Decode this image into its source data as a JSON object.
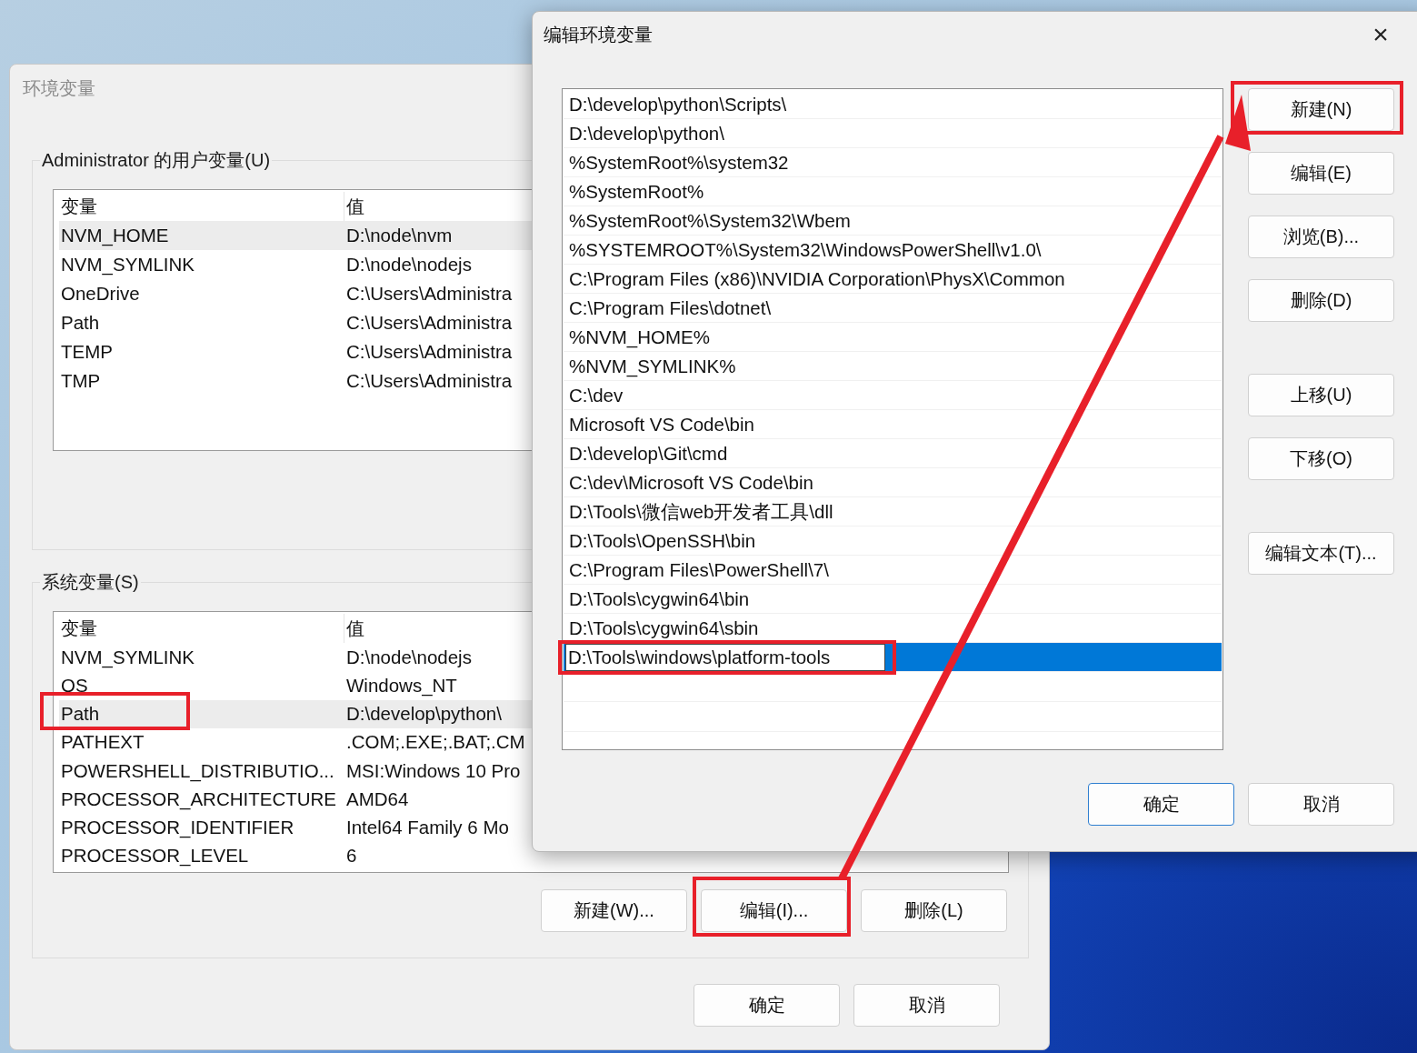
{
  "env_window": {
    "title": "环境变量",
    "user_variables": {
      "title": "Administrator 的用户变量(U)",
      "columns": [
        "变量",
        "值"
      ],
      "rows": [
        {
          "name": "NVM_HOME",
          "value": "D:\\node\\nvm",
          "selected": true
        },
        {
          "name": "NVM_SYMLINK",
          "value": "D:\\node\\nodejs",
          "selected": false
        },
        {
          "name": "OneDrive",
          "value": "C:\\Users\\Administra",
          "selected": false
        },
        {
          "name": "Path",
          "value": "C:\\Users\\Administra",
          "selected": false
        },
        {
          "name": "TEMP",
          "value": "C:\\Users\\Administra",
          "selected": false
        },
        {
          "name": "TMP",
          "value": "C:\\Users\\Administra",
          "selected": false
        }
      ]
    },
    "system_variables": {
      "title": "系统变量(S)",
      "columns": [
        "变量",
        "值"
      ],
      "rows": [
        {
          "name": "NVM_SYMLINK",
          "value": "D:\\node\\nodejs",
          "selected": false
        },
        {
          "name": "OS",
          "value": "Windows_NT",
          "selected": false
        },
        {
          "name": "Path",
          "value": "D:\\develop\\python\\",
          "selected": true
        },
        {
          "name": "PATHEXT",
          "value": ".COM;.EXE;.BAT;.CM",
          "selected": false
        },
        {
          "name": "POWERSHELL_DISTRIBUTIO...",
          "value": "MSI:Windows 10 Pro",
          "selected": false
        },
        {
          "name": "PROCESSOR_ARCHITECTURE",
          "value": "AMD64",
          "selected": false
        },
        {
          "name": "PROCESSOR_IDENTIFIER",
          "value": "Intel64 Family 6 Mo",
          "selected": false
        },
        {
          "name": "PROCESSOR_LEVEL",
          "value": "6",
          "selected": false
        }
      ],
      "buttons": [
        "新建(W)...",
        "编辑(I)...",
        "删除(L)"
      ]
    },
    "buttons": [
      "确定",
      "取消"
    ]
  },
  "edit_dialog": {
    "title": "编辑环境变量",
    "close": "×",
    "entries": [
      {
        "text": "D:\\develop\\python\\Scripts\\",
        "kind": "text",
        "selected": false
      },
      {
        "text": "D:\\develop\\python\\",
        "kind": "text",
        "selected": false
      },
      {
        "text": "%SystemRoot%\\system32",
        "kind": "text",
        "selected": false
      },
      {
        "text": "%SystemRoot%",
        "kind": "text",
        "selected": false
      },
      {
        "text": "%SystemRoot%\\System32\\Wbem",
        "kind": "text",
        "selected": false
      },
      {
        "text": "%SYSTEMROOT%\\System32\\WindowsPowerShell\\v1.0\\",
        "kind": "text",
        "selected": false
      },
      {
        "text": "C:\\Program Files (x86)\\NVIDIA Corporation\\PhysX\\Common",
        "kind": "text",
        "selected": false
      },
      {
        "text": "C:\\Program Files\\dotnet\\",
        "kind": "text",
        "selected": false
      },
      {
        "text": "%NVM_HOME%",
        "kind": "text",
        "selected": false
      },
      {
        "text": "%NVM_SYMLINK%",
        "kind": "text",
        "selected": false
      },
      {
        "text": "C:\\dev",
        "kind": "text",
        "selected": false
      },
      {
        "text": "Microsoft VS Code\\bin",
        "kind": "text",
        "selected": false
      },
      {
        "text": "D:\\develop\\Git\\cmd",
        "kind": "text",
        "selected": false
      },
      {
        "text": "C:\\dev\\Microsoft VS Code\\bin",
        "kind": "text",
        "selected": false
      },
      {
        "text": "D:\\Tools\\微信web开发者工具\\dll",
        "kind": "text",
        "selected": false
      },
      {
        "text": "D:\\Tools\\OpenSSH\\bin",
        "kind": "text",
        "selected": false
      },
      {
        "text": "C:\\Program Files\\PowerShell\\7\\",
        "kind": "text",
        "selected": false
      },
      {
        "text": "D:\\Tools\\cygwin64\\bin",
        "kind": "text",
        "selected": false
      },
      {
        "text": "D:\\Tools\\cygwin64\\sbin",
        "kind": "text",
        "selected": false
      },
      {
        "text": "D:\\Tools\\windows\\platform-tools",
        "kind": "input",
        "selected": true
      }
    ],
    "side_button_groups": [
      [
        "新建(N)",
        "编辑(E)",
        "浏览(B)...",
        "删除(D)"
      ],
      [
        "上移(U)",
        "下移(O)"
      ],
      [
        "编辑文本(T)..."
      ]
    ],
    "buttons": [
      {
        "label": "确定",
        "default": true
      },
      {
        "label": "取消",
        "default": false
      }
    ]
  }
}
